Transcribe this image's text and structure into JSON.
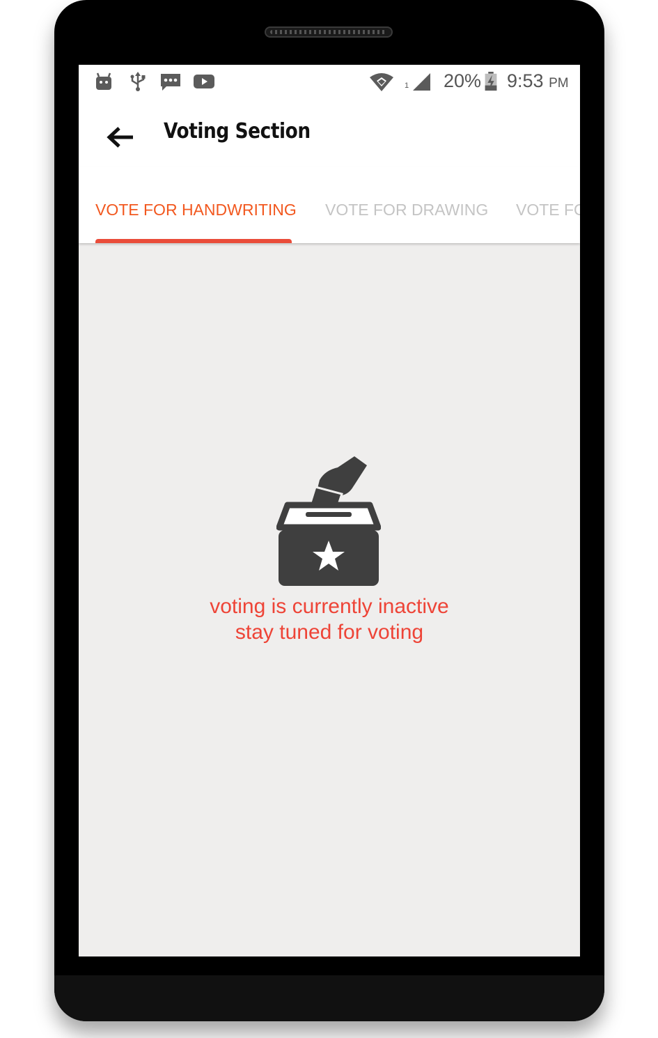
{
  "status_bar": {
    "icons": [
      "android-debug-icon",
      "usb-icon",
      "message-icon",
      "youtube-icon",
      "wifi-icon",
      "signal-icon",
      "battery-charging-icon"
    ],
    "sim_slot": "1",
    "battery_percent": "20%",
    "time": "9:53",
    "ampm": "PM"
  },
  "app_bar": {
    "back_icon": "arrow-left-icon",
    "title": "Voting Section"
  },
  "tabs": [
    {
      "label": "VOTE FOR HANDWRITING",
      "active": true
    },
    {
      "label": "VOTE FOR DRAWING",
      "active": false
    },
    {
      "label": "VOTE FOR",
      "active": false
    }
  ],
  "empty_state": {
    "icon": "ballot-box-icon",
    "line1": "voting is currently inactive",
    "line2": "stay tuned for voting"
  },
  "colors": {
    "accent": "#f2581f",
    "indicator": "#ea4c3a",
    "message": "#ee4437",
    "icon": "#3f3f3f",
    "background": "#efeeed"
  }
}
